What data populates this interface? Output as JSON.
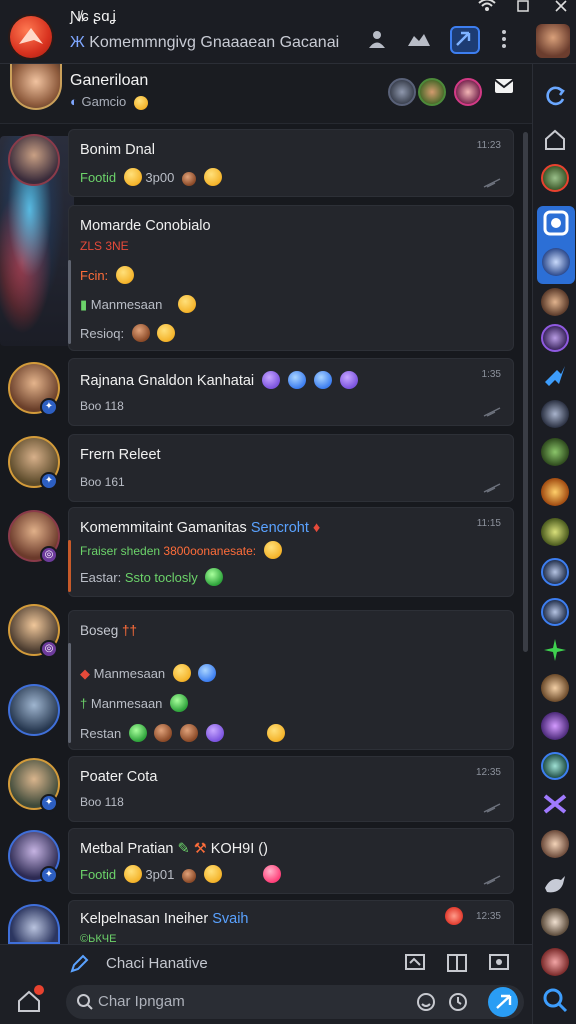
{
  "app": {
    "title": "Ɲ̸ɕ ʂɑʝ",
    "subtitle_icon": "Ж",
    "subtitle": "Komemmngivg Gnaaaean Gacanai"
  },
  "conversation": {
    "name": "Ganeriloan",
    "sub": "Gamcio"
  },
  "messages": [
    {
      "title": "Bonim Dnal",
      "time": "11:23",
      "line1": "Footid",
      "line1_extra": "3p00"
    },
    {
      "title": "Momarde Conobialo",
      "lineA": "ZLS 3NE",
      "lineB": "Fcin:",
      "lineC": "Manmesaan",
      "lineD": "Resioq:"
    },
    {
      "title": "Rajnana Gnaldon Kanhatai",
      "time": "1:35",
      "sub": "Boo 118"
    },
    {
      "title": "Frern Releet",
      "sub": "Boo 161"
    },
    {
      "title": "Komemmitaint Gamanitas",
      "title_accent": "Sencroht",
      "time": "11:15",
      "line1": "Fraiser sheden",
      "line1_accent": "3800oonanesate:",
      "line2": "Eastar:",
      "line2_extra": "Ssto toclosly"
    },
    {
      "title": "Boseg",
      "title_accent": "††",
      "line1": "Manmesaan",
      "line2": "Manmesaan",
      "line3": "Restan"
    },
    {
      "title": "Poater Cota",
      "time": "12:35",
      "sub": "Boo 118"
    },
    {
      "title": "Metbal Pratian",
      "title_extra": "KOH9I ()",
      "line1": "Footid",
      "line1_extra": "3p01"
    },
    {
      "title": "Kelpelnasan Ineiher",
      "title_accent": "Svaih",
      "time": "12:35",
      "line1": "©ЬКЧЕ"
    }
  ],
  "composer": {
    "hint": "Chaci Hanative",
    "placeholder": "Char Ipngam"
  },
  "colors": {
    "accent_blue": "#2a9df4",
    "green": "#6cd36a",
    "orange": "#ff6d3a",
    "background": "#17191e"
  }
}
